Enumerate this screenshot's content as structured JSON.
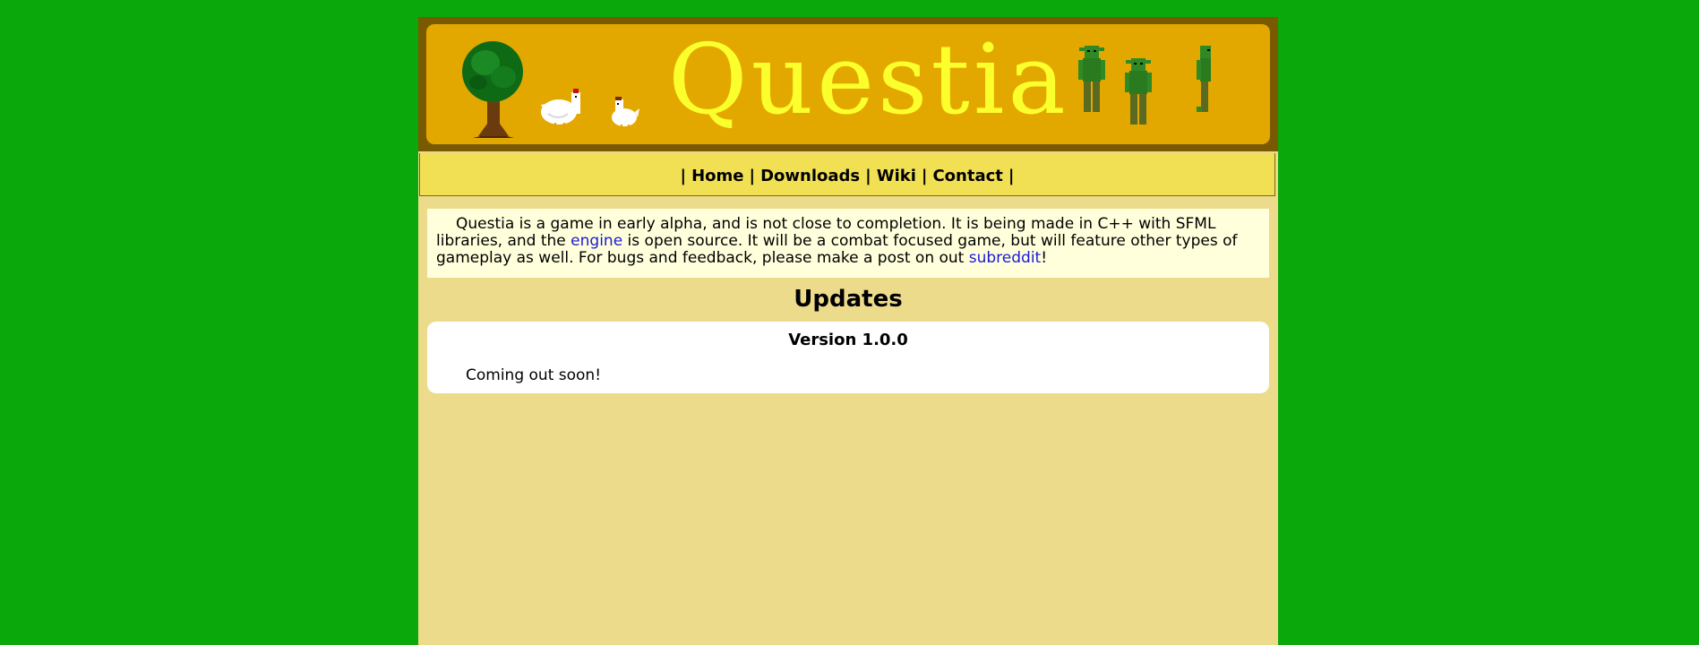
{
  "banner": {
    "logo_text": "Questia",
    "colors": {
      "frame": "#7a5a00",
      "panel": "#e3a800",
      "logo": "#fbff2c"
    },
    "art": [
      "tree-icon",
      "chicken-icon",
      "small-chicken-icon",
      "goblin-icon",
      "goblin-icon",
      "goblin-icon"
    ]
  },
  "nav": {
    "separator": "|",
    "items": [
      {
        "label": "Home"
      },
      {
        "label": "Downloads"
      },
      {
        "label": "Wiki"
      },
      {
        "label": "Contact"
      }
    ]
  },
  "intro": {
    "part1": "Questia is a game in early alpha, and is not close to completion. It is being made in C++ with SFML libraries, and the ",
    "link1": "engine",
    "part2": " is open source. It will be a combat focused game, but will feature other types of gameplay as well. For bugs and feedback, please make a post on out ",
    "link2": "subreddit",
    "part3": "!"
  },
  "updates": {
    "title": "Updates",
    "entries": [
      {
        "version": "Version 1.0.0",
        "body": "Coming out soon!"
      }
    ]
  },
  "colors": {
    "background": "#0aa80a",
    "page": "#eddb8c",
    "navbar": "#f1df54",
    "intro_box": "#ffffdc",
    "link": "#1a1ad4"
  }
}
